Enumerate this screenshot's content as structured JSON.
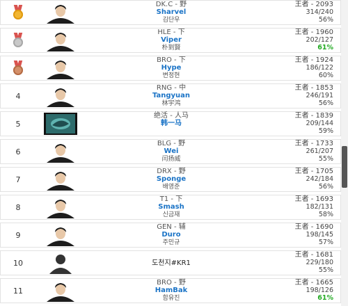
{
  "rows": [
    {
      "rank": "",
      "medal": "gold",
      "team": "DK.C - 野",
      "name": "Sharvel",
      "real": "김단우",
      "score": "王者 - 2093",
      "record": "314/240",
      "winrate": "56%",
      "wr_high": false
    },
    {
      "rank": "",
      "medal": "silver",
      "team": "HLE - 下",
      "name": "Viper",
      "real": "朴到賢",
      "score": "王者 - 1960",
      "record": "202/127",
      "winrate": "61%",
      "wr_high": true
    },
    {
      "rank": "",
      "medal": "bronze",
      "team": "BRO - 下",
      "name": "Hype",
      "real": "변정현",
      "score": "王者 - 1924",
      "record": "186/122",
      "winrate": "60%",
      "wr_high": false
    },
    {
      "rank": "4",
      "medal": "",
      "team": "RNG - 中",
      "name": "Tangyuan",
      "real": "林宇鸿",
      "score": "王者 - 1853",
      "record": "246/191",
      "winrate": "56%",
      "wr_high": false
    },
    {
      "rank": "5",
      "medal": "",
      "team": "绝活 - 人马",
      "name": "韩一马",
      "real": "",
      "score": "王者 - 1839",
      "record": "209/144",
      "winrate": "59%",
      "wr_high": false
    },
    {
      "rank": "6",
      "medal": "",
      "team": "BLG - 野",
      "name": "Wei",
      "real": "闫扬威",
      "score": "王者 - 1733",
      "record": "261/207",
      "winrate": "55%",
      "wr_high": false
    },
    {
      "rank": "7",
      "medal": "",
      "team": "DRX - 野",
      "name": "Sponge",
      "real": "배영준",
      "score": "王者 - 1705",
      "record": "242/184",
      "winrate": "56%",
      "wr_high": false
    },
    {
      "rank": "8",
      "medal": "",
      "team": "T1 - 下",
      "name": "Smash",
      "real": "신금재",
      "score": "王者 - 1693",
      "record": "182/131",
      "winrate": "58%",
      "wr_high": false
    },
    {
      "rank": "9",
      "medal": "",
      "team": "GEN - 辅",
      "name": "Duro",
      "real": "주민규",
      "score": "王者 - 1690",
      "record": "198/145",
      "winrate": "57%",
      "wr_high": false
    },
    {
      "rank": "10",
      "medal": "",
      "team": "",
      "name": "도천지#KR1",
      "real": "",
      "score": "王者 - 1681",
      "record": "229/180",
      "winrate": "55%",
      "wr_high": false
    },
    {
      "rank": "11",
      "medal": "",
      "team": "BRO - 野",
      "name": "HamBak",
      "real": "함유진",
      "score": "王者 - 1665",
      "record": "198/126",
      "winrate": "61%",
      "wr_high": true
    }
  ],
  "icons": {
    "avatar_placeholder": "person-silhouette-icon",
    "medal": "medal-icon"
  },
  "colors": {
    "name_link": "#1a73c6",
    "winrate_high": "#22aa22"
  }
}
